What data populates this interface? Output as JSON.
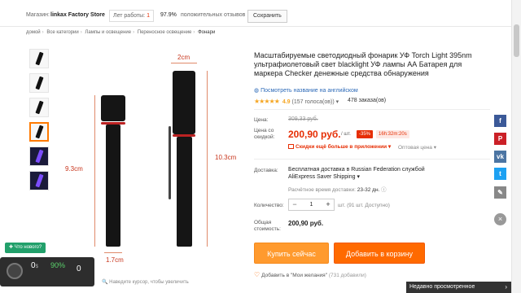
{
  "store": {
    "label": "Магазин:",
    "name": "linkax Factory Store",
    "years_label": "Лет работы:",
    "years_value": "1",
    "positive_pct": "97.9%",
    "positive_label": "положительных отзывов",
    "save_label": "Сохранить"
  },
  "breadcrumb": [
    "домой",
    "Все категории",
    "Лампы и освещение",
    "Переносное освещение",
    "Фонари"
  ],
  "image": {
    "dim_top": "2cm",
    "dim_left": "9.3cm",
    "dim_right": "10.3cm",
    "dim_bottom": "1.7cm",
    "zoom_hint": "Наведите курсор, чтобы увеличить"
  },
  "product": {
    "title": "Масштабируемые светодиодный фонарик УФ Torch Light 395nm ультрафиолетовый свет blacklight УФ лампы АА Батарея для маркера Checker денежные средства обнаружения",
    "translate_link": "Посмотреть название на английском",
    "stars": "★★★★★",
    "rating": "4.9",
    "votes": "(157 голоса(ов))",
    "orders": "478 заказа(ов)"
  },
  "price": {
    "price_label": "Цена:",
    "old_price": "309,33 руб.",
    "discount_label": "Цена со скидкой:",
    "new_price": "200,90 руб.",
    "per_unit": "/ шт.",
    "discount_pct": "-35%",
    "timer": "16h:32m:20s",
    "app_discount": "Скидки ещё больше в приложении",
    "wholesale": "Оптовая цена"
  },
  "shipping": {
    "label": "Доставка:",
    "main": "Бесплатная доставка в Russian Federation службой AliExpress Saver Shipping",
    "est_label": "Расчётное время доставки:",
    "est_value": "23-32 дн."
  },
  "quantity": {
    "label": "Количество:",
    "value": "1",
    "available": "шт. (91 шт. Доступно)"
  },
  "total": {
    "label": "Общая стоимость:",
    "value": "200,90 руб."
  },
  "actions": {
    "buy": "Купить сейчас",
    "cart": "Добавить в корзину",
    "wish": "Добавить в \"Мои желания\"",
    "wish_count": "(731 добавили)"
  },
  "widget": {
    "whats_new": "Что нового?",
    "zero": "0",
    "currency": "$",
    "pct": "90%",
    "count": "0"
  },
  "recent": {
    "label": "Недавно просмотренное"
  },
  "colors": {
    "accent_orange": "#ff6a00",
    "price_red": "#e62e04",
    "link_blue": "#2d6ab8"
  }
}
